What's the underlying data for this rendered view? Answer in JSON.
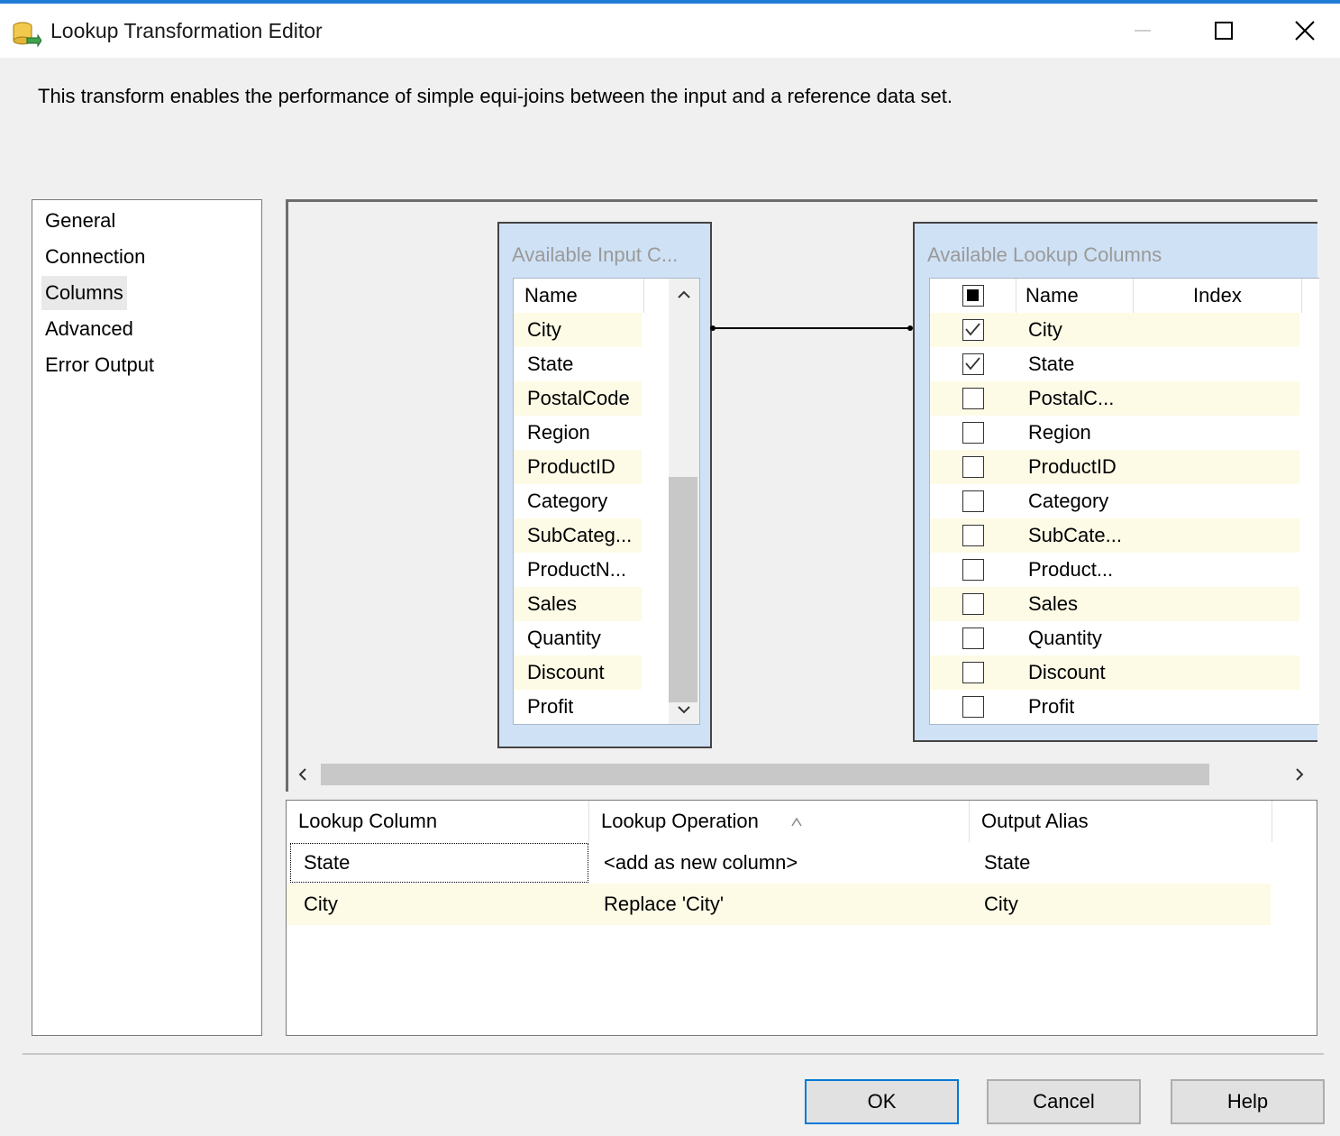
{
  "window": {
    "title": "Lookup Transformation Editor",
    "icon": "lookup-transform-icon",
    "controls": [
      "minimize-icon",
      "maximize-icon",
      "close-icon"
    ]
  },
  "description": "This transform enables the performance of simple equi-joins between the input and a reference data set.",
  "nav": {
    "items": [
      "General",
      "Connection",
      "Columns",
      "Advanced",
      "Error Output"
    ],
    "selected": "Columns"
  },
  "input_table": {
    "caption": "Available Input C...",
    "header": "Name",
    "rows": [
      "City",
      "State",
      "PostalCode",
      "Region",
      "ProductID",
      "Category",
      "SubCateg...",
      "ProductN...",
      "Sales",
      "Quantity",
      "Discount",
      "Profit"
    ]
  },
  "lookup_table": {
    "caption": "Available Lookup Columns",
    "headers": {
      "name": "Name",
      "index": "Index"
    },
    "rows": [
      {
        "name": "City",
        "checked": true
      },
      {
        "name": "State",
        "checked": true
      },
      {
        "name": "PostalC...",
        "checked": false
      },
      {
        "name": "Region",
        "checked": false
      },
      {
        "name": "ProductID",
        "checked": false
      },
      {
        "name": "Category",
        "checked": false
      },
      {
        "name": "SubCate...",
        "checked": false
      },
      {
        "name": "Product...",
        "checked": false
      },
      {
        "name": "Sales",
        "checked": false
      },
      {
        "name": "Quantity",
        "checked": false
      },
      {
        "name": "Discount",
        "checked": false
      },
      {
        "name": "Profit",
        "checked": false
      }
    ]
  },
  "mapping_grid": {
    "headers": {
      "lookup_column": "Lookup Column",
      "lookup_operation": "Lookup Operation",
      "output_alias": "Output Alias"
    },
    "rows": [
      {
        "lookup_column": "State",
        "lookup_operation": "<add as new column>",
        "output_alias": "State"
      },
      {
        "lookup_column": "City",
        "lookup_operation": "Replace 'City'",
        "output_alias": "City"
      }
    ]
  },
  "buttons": {
    "ok": "OK",
    "cancel": "Cancel",
    "help": "Help"
  },
  "colors": {
    "accent": "#0078d7",
    "row_alt": "#fdfbe6",
    "table_frame": "#cfe1f5"
  }
}
